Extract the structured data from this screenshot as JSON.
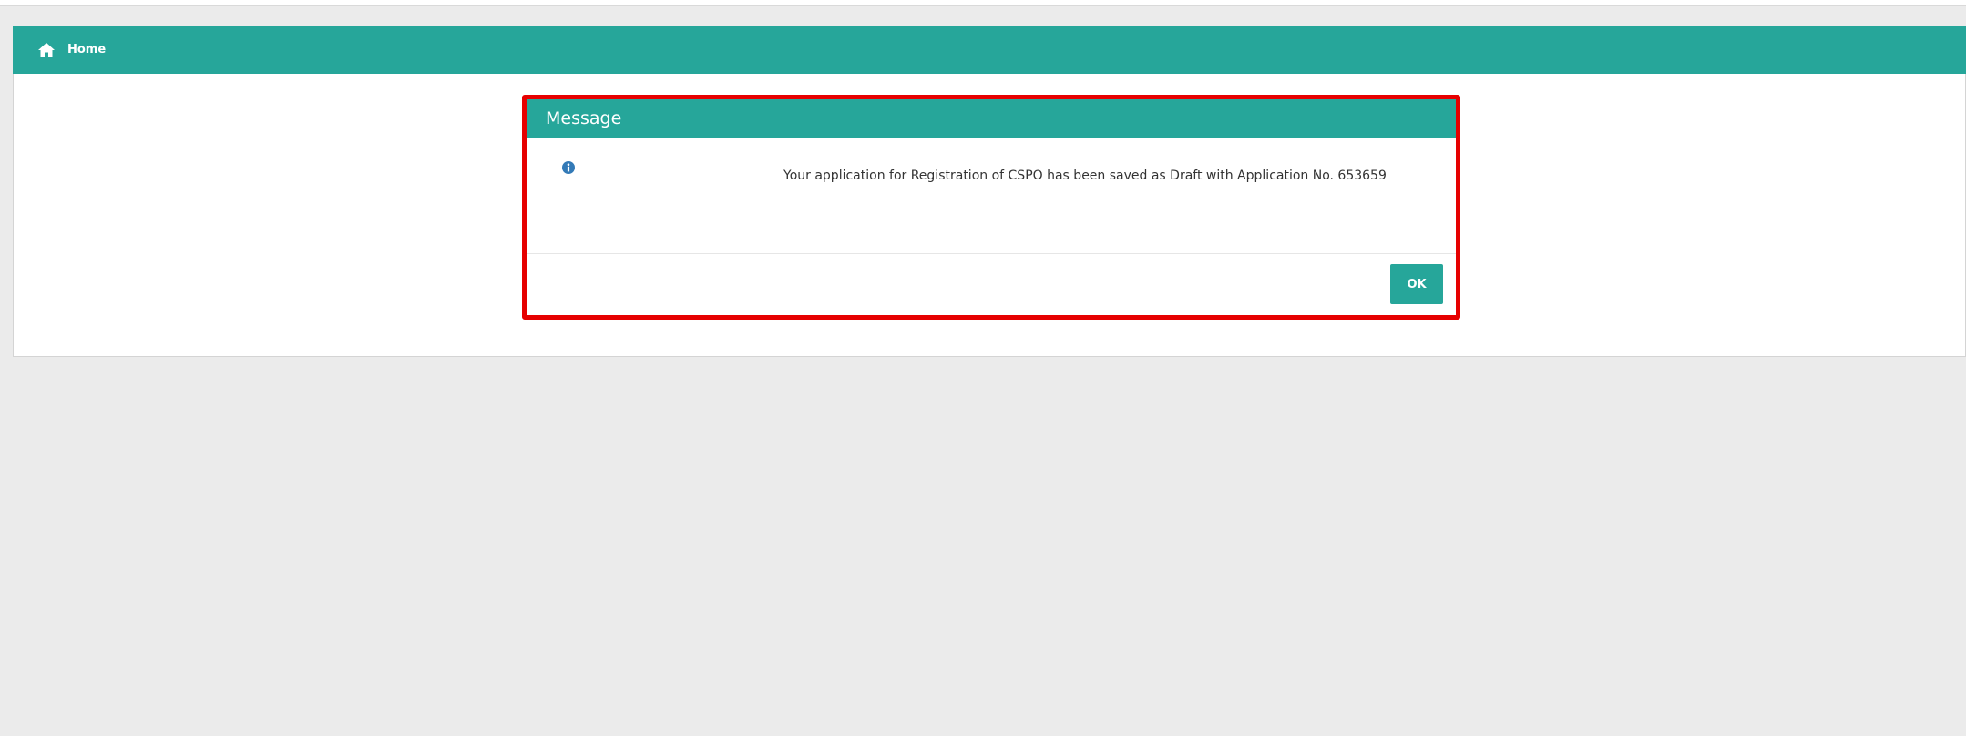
{
  "nav": {
    "home_label": "Home",
    "icon": "home-icon"
  },
  "dialog": {
    "title": "Message",
    "icon": "info-icon",
    "message": "Your application for Registration of CSPO has been saved as Draft with Application No. 653659",
    "ok_label": "OK"
  },
  "colors": {
    "accent": "#26a69a",
    "highlight_border": "#e60000",
    "page_background": "#ebebeb"
  }
}
